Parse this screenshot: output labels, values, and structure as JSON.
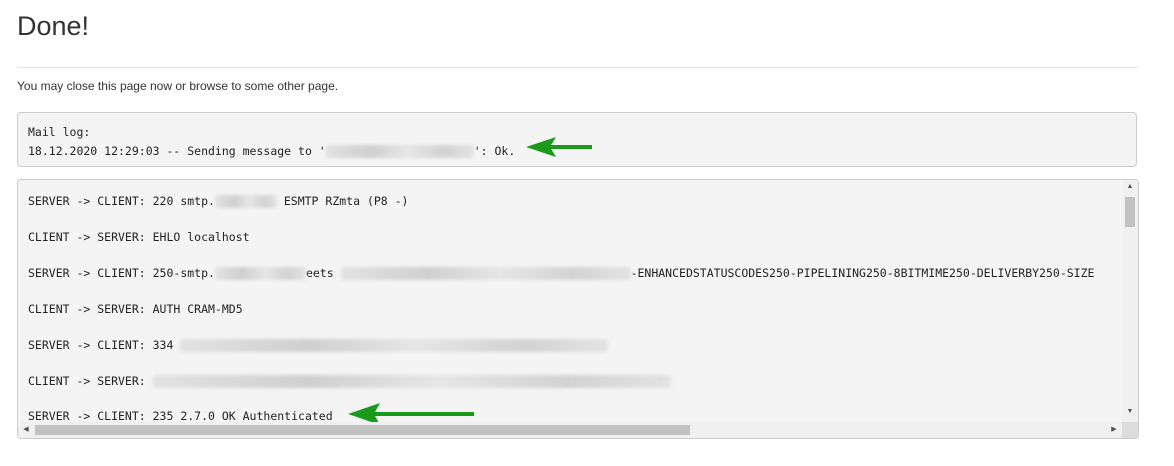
{
  "page": {
    "title": "Done!",
    "message": "You may close this page now or browse to some other page."
  },
  "mail_log": {
    "heading": "Mail log:",
    "line_prefix": "18.12.2020 12:29:03 -- Sending message to '",
    "line_suffix": "': Ok."
  },
  "smtp_log": {
    "line1_a": "SERVER -> CLIENT: 220 smtp.",
    "line1_b": " ESMTP RZmta (P8 -)",
    "line2": "CLIENT -> SERVER: EHLO localhost",
    "line3_a": "SERVER -> CLIENT: 250-smtp.",
    "line3_b": "eets ",
    "line3_c": "-ENHANCEDSTATUSCODES250-PIPELINING250-8BITMIME250-DELIVERBY250-SIZE",
    "line4": "CLIENT -> SERVER: AUTH CRAM-MD5",
    "line5": "SERVER -> CLIENT: 334 ",
    "line6": "CLIENT -> SERVER: ",
    "line7": "SERVER -> CLIENT: 235 2.7.0 OK Authenticated"
  },
  "scrollbar": {
    "arrow_up": "▲",
    "arrow_down": "▼",
    "arrow_left": "◀",
    "arrow_right": "▶"
  },
  "colors": {
    "annotation_arrow": "#1a9a1a",
    "panel_background": "#f4f4f4",
    "panel_border": "#cccccc"
  }
}
